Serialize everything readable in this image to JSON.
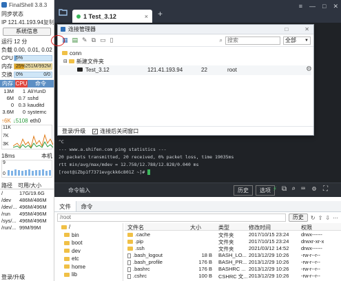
{
  "app": {
    "title": "FinalShell 3.8.3"
  },
  "sidebar": {
    "sync_status": "同步状态",
    "ip": "IP 121.41.193.94",
    "copy": "复制",
    "sysinfo_button": "系统信息",
    "uptime": "运行 12 分",
    "load": "负载 0.00, 0.01, 0.02",
    "cpu_label": "CPU",
    "cpu_value": "5%",
    "cpu_fraction": 0.05,
    "mem_label": "内存",
    "mem_value": "25%",
    "mem_detail": "251M/992M",
    "mem_fraction": 0.25,
    "swap_label": "交换",
    "swap_value": "0%",
    "swap_detail": "0/0",
    "proc_headers": [
      "内存",
      "CPU",
      "命令"
    ],
    "processes": [
      {
        "mem": "13M",
        "cpu": "1",
        "cmd": "AliYunD"
      },
      {
        "mem": "6M",
        "cpu": "0.7",
        "cmd": "sshd"
      },
      {
        "mem": "0",
        "cpu": "0.3",
        "cmd": "kauditd"
      },
      {
        "mem": "3.6M",
        "cpu": "0",
        "cmd": "systemc"
      }
    ],
    "net_up": "↑6K",
    "net_down": "↓5108",
    "net_iface": "eth0",
    "net_scale": [
      "11K",
      "7K",
      "3K"
    ],
    "latency_label": "18ms",
    "latency_local": "本机",
    "latency_scale": [
      "9",
      "0"
    ],
    "disk_headers": [
      "路径",
      "可用/大小"
    ],
    "disks": [
      {
        "path": "/",
        "size": "17G/19.6G"
      },
      {
        "path": "/dev",
        "size": "486M/486M"
      },
      {
        "path": "/dev/...",
        "size": "496M/496M"
      },
      {
        "path": "/run",
        "size": "495M/496M"
      },
      {
        "path": "/sys/...",
        "size": "496M/496M"
      },
      {
        "path": "/run/...",
        "size": "99M/99M"
      }
    ],
    "login_upgrade": "登录/升级"
  },
  "tabs": {
    "active": "1 Test_3.12",
    "add": "+"
  },
  "dialog": {
    "title": "连接管理器",
    "search_placeholder": "搜索",
    "filter_value": "全部",
    "tree_root": "conn",
    "tree_folder": "新建文件夹",
    "connection": {
      "name": "Test_3.12",
      "host": "121.41.193.94",
      "port": "22",
      "user": "root"
    },
    "login_upgrade": "登录/升级",
    "close_after": "连接后关闭窗口"
  },
  "terminal": {
    "lines": [
      "^C",
      "--- www.a.shifen.com ping statistics ---",
      "20 packets transmitted, 20 received, 0% packet loss, time 19035ms",
      "rtt min/avg/max/mdev = 12.758/12.788/12.828/0.040 ms",
      "[root@iZbp1f7371evgckk6c801Z ~]# "
    ],
    "cmd_input": "命令输入",
    "history": "历史",
    "options": "选项"
  },
  "filepanel": {
    "tabs": [
      "文件",
      "命令"
    ],
    "path": "/root",
    "history": "历史",
    "tree": [
      "/",
      "bin",
      "boot",
      "dev",
      "etc",
      "home",
      "lib"
    ],
    "columns": [
      "文件名",
      "大小",
      "类型",
      "修改时间",
      "权限"
    ],
    "files": [
      {
        "name": ".cache",
        "size": "",
        "type": "文件夹",
        "mtime": "2017/10/15 23:24",
        "perm": "drwx------"
      },
      {
        "name": ".pip",
        "size": "",
        "type": "文件夹",
        "mtime": "2017/10/15 23:24",
        "perm": "drwxr-xr-x"
      },
      {
        "name": ".ssh",
        "size": "",
        "type": "文件夹",
        "mtime": "2021/03/12 14:52",
        "perm": "drwx------"
      },
      {
        "name": ".bash_logout",
        "size": "18 B",
        "type": "BASH_LO...",
        "mtime": "2013/12/29 10:26",
        "perm": "-rw-r--r--"
      },
      {
        "name": ".bash_profile",
        "size": "176 B",
        "type": "BASH_PR...",
        "mtime": "2013/12/29 10:26",
        "perm": "-rw-r--r--"
      },
      {
        "name": ".bashrc",
        "size": "176 B",
        "type": "BASHRC ...",
        "mtime": "2013/12/29 10:26",
        "perm": "-rw-r--r--"
      },
      {
        "name": ".cshrc",
        "size": "100 B",
        "type": "CSHRC 文...",
        "mtime": "2013/12/29 10:26",
        "perm": "-rw-r--r--"
      }
    ]
  }
}
